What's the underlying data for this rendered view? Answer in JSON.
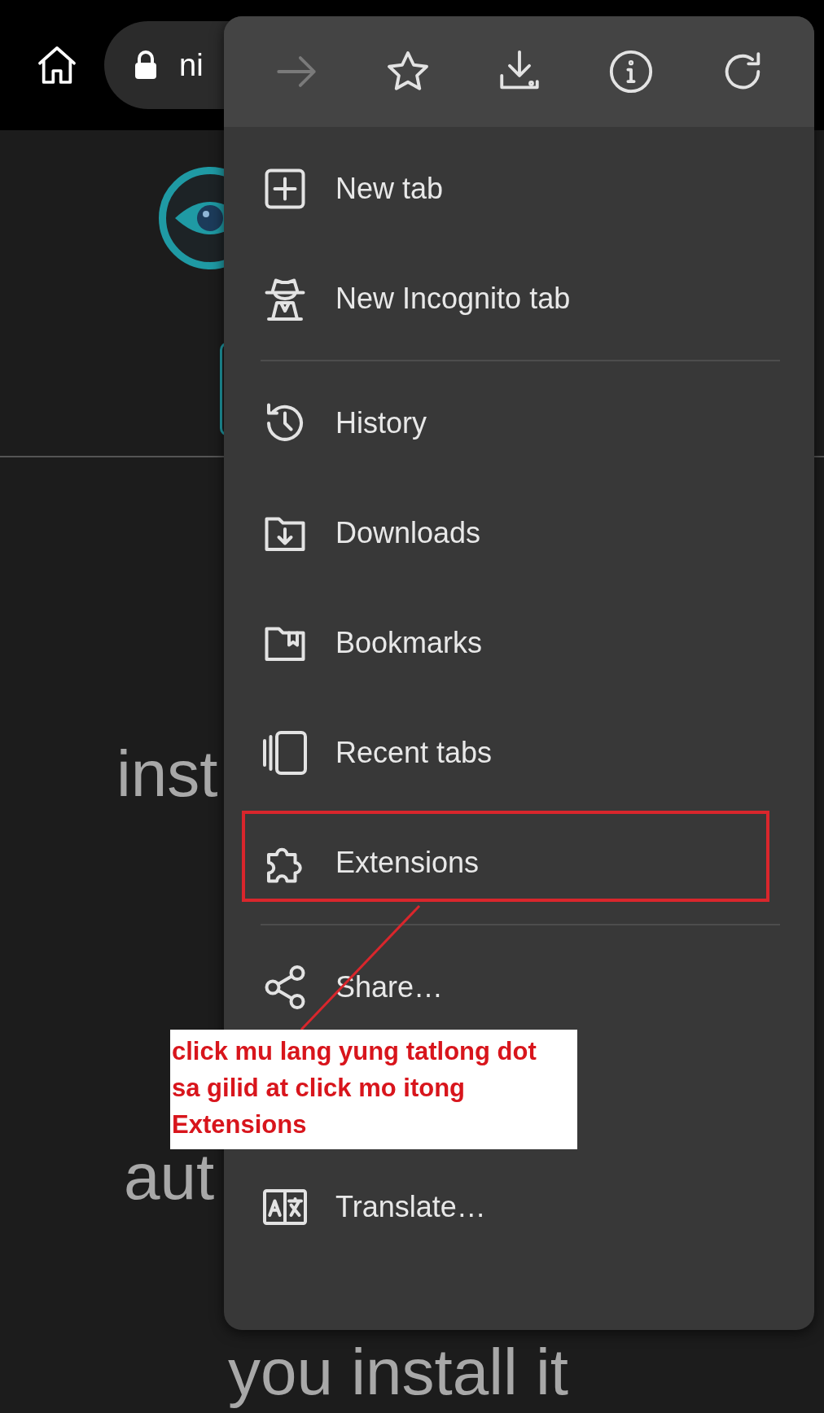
{
  "browser_bar": {
    "url": "ni"
  },
  "page": {
    "texts": [
      "inst",
      "aut",
      "you install it"
    ]
  },
  "menu": {
    "toolbar": [
      {
        "kind": "forward",
        "disabled": true
      },
      {
        "kind": "star",
        "disabled": false
      },
      {
        "kind": "download",
        "disabled": false
      },
      {
        "kind": "info",
        "disabled": false
      },
      {
        "kind": "refresh",
        "disabled": false
      }
    ],
    "groups": [
      [
        {
          "kind": "new-tab",
          "label": "New tab",
          "highlighted": false
        },
        {
          "kind": "incognito",
          "label": "New Incognito tab",
          "highlighted": false
        }
      ],
      [
        {
          "kind": "history",
          "label": "History",
          "highlighted": false
        },
        {
          "kind": "downloads",
          "label": "Downloads",
          "highlighted": false
        },
        {
          "kind": "bookmarks",
          "label": "Bookmarks",
          "highlighted": false
        },
        {
          "kind": "recent-tabs",
          "label": "Recent tabs",
          "highlighted": false
        },
        {
          "kind": "extensions",
          "label": "Extensions",
          "highlighted": true
        }
      ],
      [
        {
          "kind": "share",
          "label": "Share…",
          "highlighted": false
        },
        {
          "kind": "hidden",
          "highlighted": false
        },
        {
          "kind": "translate",
          "label": "Translate…",
          "highlighted": false
        }
      ]
    ]
  },
  "annotation": {
    "text": "click mu lang yung tatlong dot sa gilid at click mo itong Extensions"
  }
}
